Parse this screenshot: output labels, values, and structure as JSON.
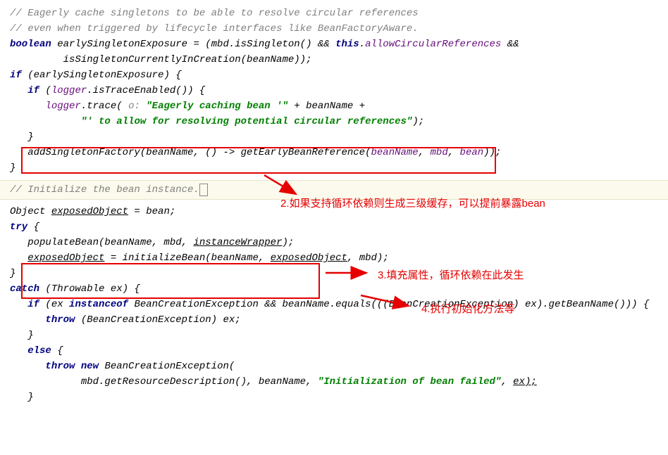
{
  "code": {
    "c1": "// Eagerly cache singletons to be able to resolve circular references",
    "c2": "// even when triggered by lifecycle interfaces like BeanFactoryAware.",
    "l3_kw": "boolean",
    "l3_var": " earlySingletonExposure = (mbd.isSingleton() && ",
    "l3_this": "this",
    "l3_dot": ".",
    "l3_field": "allowCircularReferences",
    "l3_tail": " &&",
    "l4": "         isSingletonCurrentlyInCreation(beanName));",
    "l5_if": "if",
    "l5_cond": " (earlySingletonExposure) {",
    "l6_if": "if",
    "l6_cond": " (",
    "l6_logger": "logger",
    "l6_tail": ".isTraceEnabled()) {",
    "l7_logger": "logger",
    "l7_a": ".trace( ",
    "l7_hint": "o: ",
    "l7_str1": "\"Eagerly caching bean '\"",
    "l7_plus": " + beanName +",
    "l8_str": "\"' to allow for resolving potential circular references\"",
    "l8_tail": ");",
    "l9": "   }",
    "l10_a": "   addSingletonFactory(beanName, () -> getEarlyBeanReference(",
    "l10_p1": "beanName",
    "l10_s1": ", ",
    "l10_p2": "mbd",
    "l10_s2": ", ",
    "l10_p3": "bean",
    "l10_tail": "));",
    "l11": "}",
    "cInit": "// Initialize the bean instance.",
    "l12": "Object ",
    "l12_exp": "exposedObject",
    "l12_tail": " = bean;",
    "l13_try": "try",
    "l13_b": " {",
    "l14_a": "   populateBean(beanName, mbd, ",
    "l14_iw": "instanceWrapper",
    "l14_tail": ");",
    "l15_exp": "exposedObject",
    "l15_mid": " = initializeBean(beanName, ",
    "l15_exp2": "exposedObject",
    "l15_tail": ", mbd);",
    "l16": "}",
    "l17_catch": "catch",
    "l17_a": " (Throwable ex) {",
    "l18_if": "if",
    "l18_a": " (ex ",
    "l18_inst": "instanceof",
    "l18_b": " BeanCreationException && beanName.equals(((BeanCreationException) ex).getBeanName())) {",
    "l19_throw": "throw",
    "l19_a": " (BeanCreationException) ex;",
    "l20": "   }",
    "l21_else": "else",
    "l21_b": " {",
    "l22_throw": "throw new",
    "l22_a": " BeanCreationException(",
    "l23_a": "            mbd.getResourceDescription(), beanName, ",
    "l23_str": "\"Initialization of bean failed\"",
    "l23_tail": ", ",
    "l23_ex": "ex);",
    "l24": "   }"
  },
  "annotations": {
    "a2": "2.如果支持循环依赖则生成三级缓存，可以提前暴露bean",
    "a3": "3.填充属性，循环依赖在此发生",
    "a4": "4.执行初始化方法等"
  }
}
